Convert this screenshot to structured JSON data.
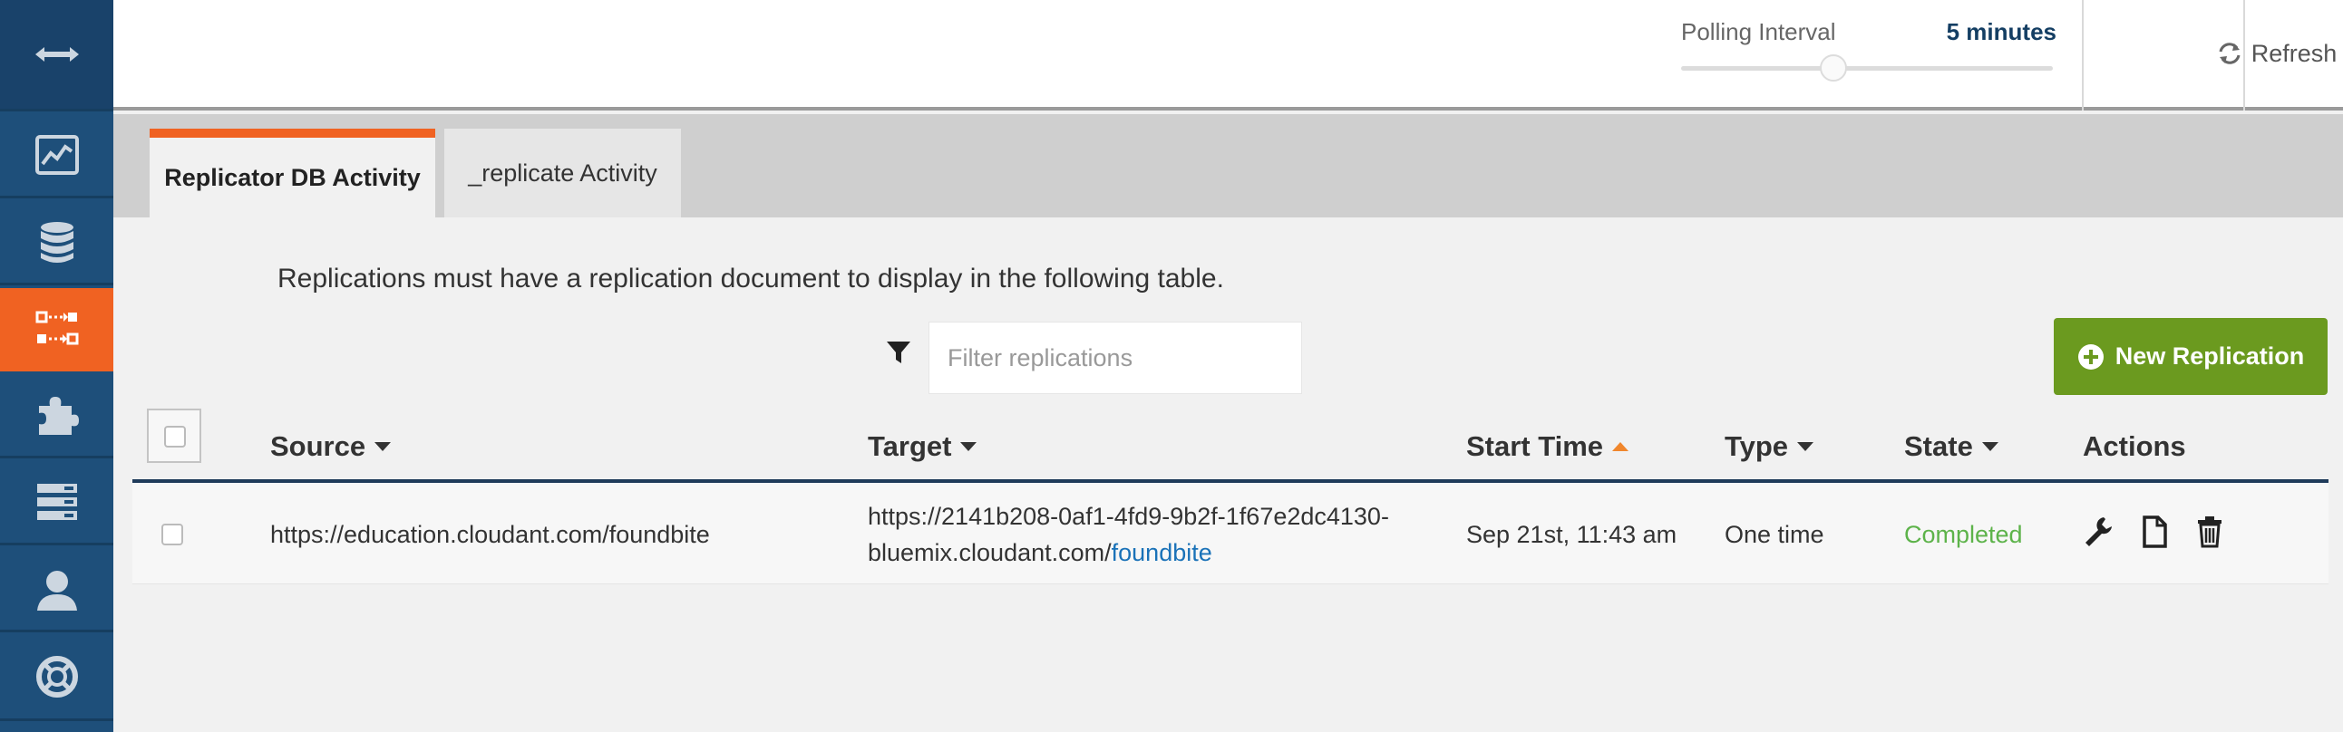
{
  "sidebar": {
    "items": [
      {
        "icon": "arrows-horizontal-icon"
      },
      {
        "icon": "activity-chart-icon"
      },
      {
        "icon": "database-icon"
      },
      {
        "icon": "replication-icon",
        "active": true
      },
      {
        "icon": "puzzle-piece-icon"
      },
      {
        "icon": "server-stack-icon"
      },
      {
        "icon": "user-icon"
      },
      {
        "icon": "support-lifebuoy-icon"
      }
    ]
  },
  "header": {
    "polling_label": "Polling Interval",
    "polling_value": "5 minutes",
    "polling_level": 0.41,
    "refresh_label": "Refresh"
  },
  "tabs": [
    {
      "label": "Replicator DB Activity",
      "active": true
    },
    {
      "label": "_replicate Activity",
      "active": false
    }
  ],
  "notice": "Replications must have a replication document to display in the following table.",
  "filter": {
    "placeholder": "Filter replications",
    "value": ""
  },
  "new_replication_label": "New Replication",
  "table": {
    "headers": {
      "source": "Source",
      "target": "Target",
      "start_time": "Start Time",
      "type": "Type",
      "state": "State",
      "actions": "Actions"
    },
    "rows": [
      {
        "source": "https://education.cloudant.com/foundbite",
        "target_line1": "https://2141b208-0af1-4fd9-9b2f-1f67e2dc4130-",
        "target_line2": "bluemix.cloudant.com/",
        "target_link": "foundbite",
        "start_time": "Sep 21st, 11:43 am",
        "type": "One time",
        "state": "Completed"
      }
    ]
  },
  "colors": {
    "sidebar": "#1e4f7a",
    "active": "#f06222",
    "primary_button": "#6b9a1f",
    "status_completed": "#5db34a",
    "link": "#1a72b8"
  }
}
